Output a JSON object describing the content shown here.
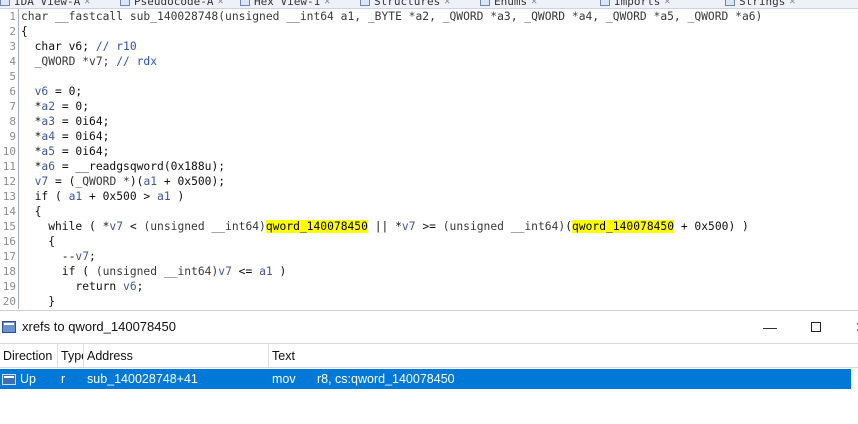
{
  "tabs": [
    {
      "label": "IDA View-A",
      "icon": "ida-view-icon"
    },
    {
      "label": "Pseudocode-A",
      "icon": "pseudocode-icon"
    },
    {
      "label": "Hex View-1",
      "icon": "hex-view-icon"
    },
    {
      "label": "Structures",
      "icon": "structures-icon"
    },
    {
      "label": "Enums",
      "icon": "enums-icon"
    },
    {
      "label": "Imports",
      "icon": "imports-icon"
    },
    {
      "label": "Strings",
      "icon": "strings-icon"
    }
  ],
  "code": {
    "lines": [
      {
        "n": "1",
        "parts": [
          {
            "c": "ty",
            "t": "char __fastcall sub_140028748(unsigned __int64 a1, _BYTE *a2, _QWORD *a3, _QWORD *a4, _QWORD *a5, _QWORD *a6)"
          }
        ]
      },
      {
        "n": "2",
        "parts": [
          {
            "c": "kw",
            "t": "{"
          }
        ]
      },
      {
        "n": "3",
        "parts": [
          {
            "c": "kw",
            "t": "  char v6; "
          },
          {
            "c": "cm",
            "t": "// r10"
          }
        ]
      },
      {
        "n": "4",
        "parts": [
          {
            "c": "ty",
            "t": "  _QWORD *v7; "
          },
          {
            "c": "cm",
            "t": "// rdx"
          }
        ]
      },
      {
        "n": "5",
        "parts": []
      },
      {
        "n": "6",
        "parts": [
          {
            "c": "vrs",
            "t": "  v6"
          },
          {
            "c": "kw",
            "t": " = 0;"
          }
        ]
      },
      {
        "n": "7",
        "parts": [
          {
            "c": "kw",
            "t": "  *"
          },
          {
            "c": "vrs",
            "t": "a2"
          },
          {
            "c": "kw",
            "t": " = 0;"
          }
        ]
      },
      {
        "n": "8",
        "parts": [
          {
            "c": "kw",
            "t": "  *"
          },
          {
            "c": "vrs",
            "t": "a3"
          },
          {
            "c": "kw",
            "t": " = 0i64;"
          }
        ]
      },
      {
        "n": "9",
        "parts": [
          {
            "c": "kw",
            "t": "  *"
          },
          {
            "c": "vrs",
            "t": "a4"
          },
          {
            "c": "kw",
            "t": " = 0i64;"
          }
        ]
      },
      {
        "n": "10",
        "parts": [
          {
            "c": "kw",
            "t": "  *"
          },
          {
            "c": "vrs",
            "t": "a5"
          },
          {
            "c": "kw",
            "t": " = 0i64;"
          }
        ]
      },
      {
        "n": "11",
        "parts": [
          {
            "c": "kw",
            "t": "  *"
          },
          {
            "c": "vrs",
            "t": "a6"
          },
          {
            "c": "kw",
            "t": " = __readgsqword(0x188u);"
          }
        ]
      },
      {
        "n": "12",
        "parts": [
          {
            "c": "vrs",
            "t": "  v7"
          },
          {
            "c": "kw",
            "t": " = ("
          },
          {
            "c": "ty",
            "t": "_QWORD *"
          },
          {
            "c": "kw",
            "t": ")("
          },
          {
            "c": "vrs",
            "t": "a1"
          },
          {
            "c": "kw",
            "t": " + 0x500);"
          }
        ]
      },
      {
        "n": "13",
        "parts": [
          {
            "c": "kw",
            "t": "  if ( "
          },
          {
            "c": "vrs",
            "t": "a1"
          },
          {
            "c": "kw",
            "t": " + 0x500 > "
          },
          {
            "c": "vrs",
            "t": "a1"
          },
          {
            "c": "kw",
            "t": " )"
          }
        ]
      },
      {
        "n": "14",
        "parts": [
          {
            "c": "kw",
            "t": "  {"
          }
        ]
      },
      {
        "n": "15",
        "parts": [
          {
            "c": "kw",
            "t": "    while ( *"
          },
          {
            "c": "vrs",
            "t": "v7"
          },
          {
            "c": "kw",
            "t": " < "
          },
          {
            "c": "ty",
            "t": "(unsigned __int64)"
          },
          {
            "c": "hl",
            "t": "qword_140078450"
          },
          {
            "c": "kw",
            "t": " || *"
          },
          {
            "c": "vrs",
            "t": "v7"
          },
          {
            "c": "kw",
            "t": " >= "
          },
          {
            "c": "ty",
            "t": "(unsigned __int64)"
          },
          {
            "c": "kw",
            "t": "("
          },
          {
            "c": "hl",
            "t": "qword_140078450"
          },
          {
            "c": "kw",
            "t": " + 0x500) )"
          }
        ]
      },
      {
        "n": "16",
        "parts": [
          {
            "c": "kw",
            "t": "    {"
          }
        ]
      },
      {
        "n": "17",
        "parts": [
          {
            "c": "kw",
            "t": "      --"
          },
          {
            "c": "vrs",
            "t": "v7"
          },
          {
            "c": "kw",
            "t": ";"
          }
        ]
      },
      {
        "n": "18",
        "parts": [
          {
            "c": "kw",
            "t": "      if ( "
          },
          {
            "c": "ty",
            "t": "(unsigned __int64)"
          },
          {
            "c": "vrs",
            "t": "v7"
          },
          {
            "c": "kw",
            "t": " <= "
          },
          {
            "c": "vrs",
            "t": "a1"
          },
          {
            "c": "kw",
            "t": " )"
          }
        ]
      },
      {
        "n": "19",
        "parts": [
          {
            "c": "kw",
            "t": "        return "
          },
          {
            "c": "vrs",
            "t": "v6"
          },
          {
            "c": "kw",
            "t": ";"
          }
        ]
      },
      {
        "n": "20",
        "parts": [
          {
            "c": "kw",
            "t": "    }"
          }
        ]
      }
    ]
  },
  "xrefs_panel": {
    "title": "xrefs to qword_140078450",
    "minimize": "—",
    "close": "✕",
    "columns": [
      "Direction",
      "Type",
      "Address",
      "Text"
    ],
    "rows": [
      {
        "direction": "Up",
        "type": "r",
        "address": "sub_140028748+41",
        "mnemonic": "mov",
        "operands": "r8, cs:qword_140078450"
      }
    ]
  }
}
